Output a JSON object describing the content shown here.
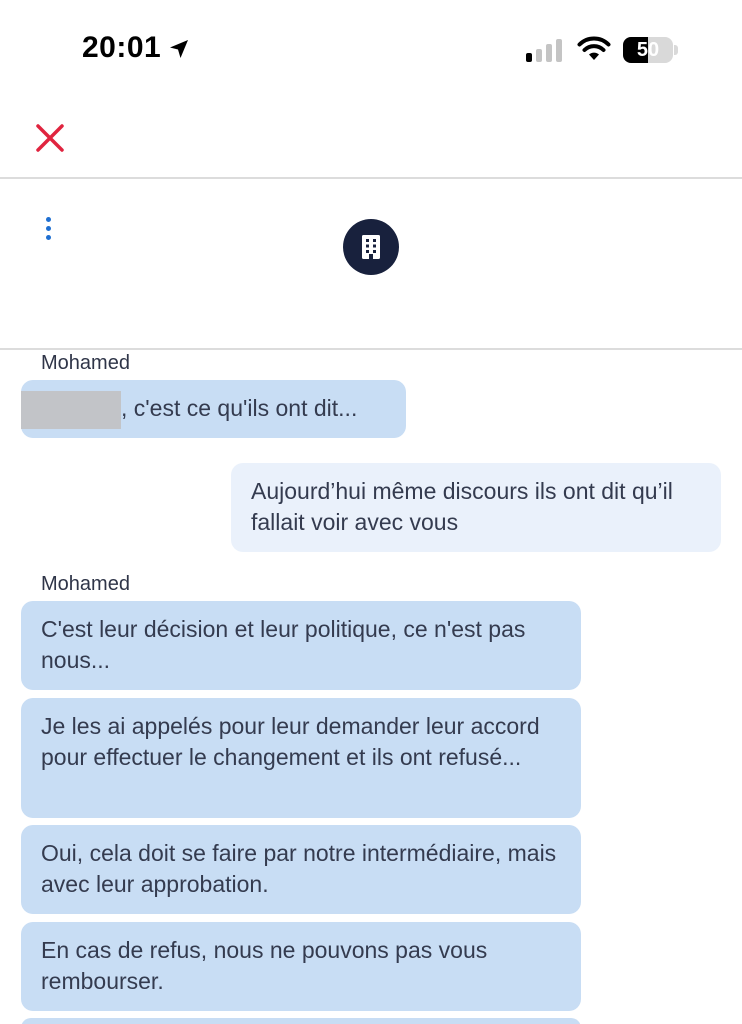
{
  "status_bar": {
    "time": "20:01",
    "battery_percent": "50",
    "battery_level": 0.5,
    "signal_bars_active": 1
  },
  "header": {
    "close_icon": "close-x-icon",
    "menu_icon": "more-vertical-icon",
    "avatar_icon": "building-icon"
  },
  "colors": {
    "close_red": "#e0243f",
    "menu_blue": "#1f6fd1",
    "avatar_bg": "#18213d",
    "incoming_bubble": "#c8ddf4",
    "outgoing_bubble": "#eaf1fb"
  },
  "messages": [
    {
      "sender": "Mohamed"
    },
    {
      "text": ", c'est ce qu'ils ont dit...",
      "redacted_prefix": true
    },
    {
      "text": "Aujourd’hui même discours ils ont dit qu’il fallait voir avec vous"
    },
    {
      "sender": "Mohamed"
    },
    {
      "text": "C'est leur décision et leur politique, ce n'est pas nous..."
    },
    {
      "text": "Je les ai appelés pour leur demander leur accord pour effectuer le changement et ils ont refusé..."
    },
    {
      "text": "Oui, cela doit se faire par notre intermédiaire, mais avec leur approbation."
    },
    {
      "text": "En cas de refus, nous ne pouvons pas vous rembourser."
    }
  ]
}
